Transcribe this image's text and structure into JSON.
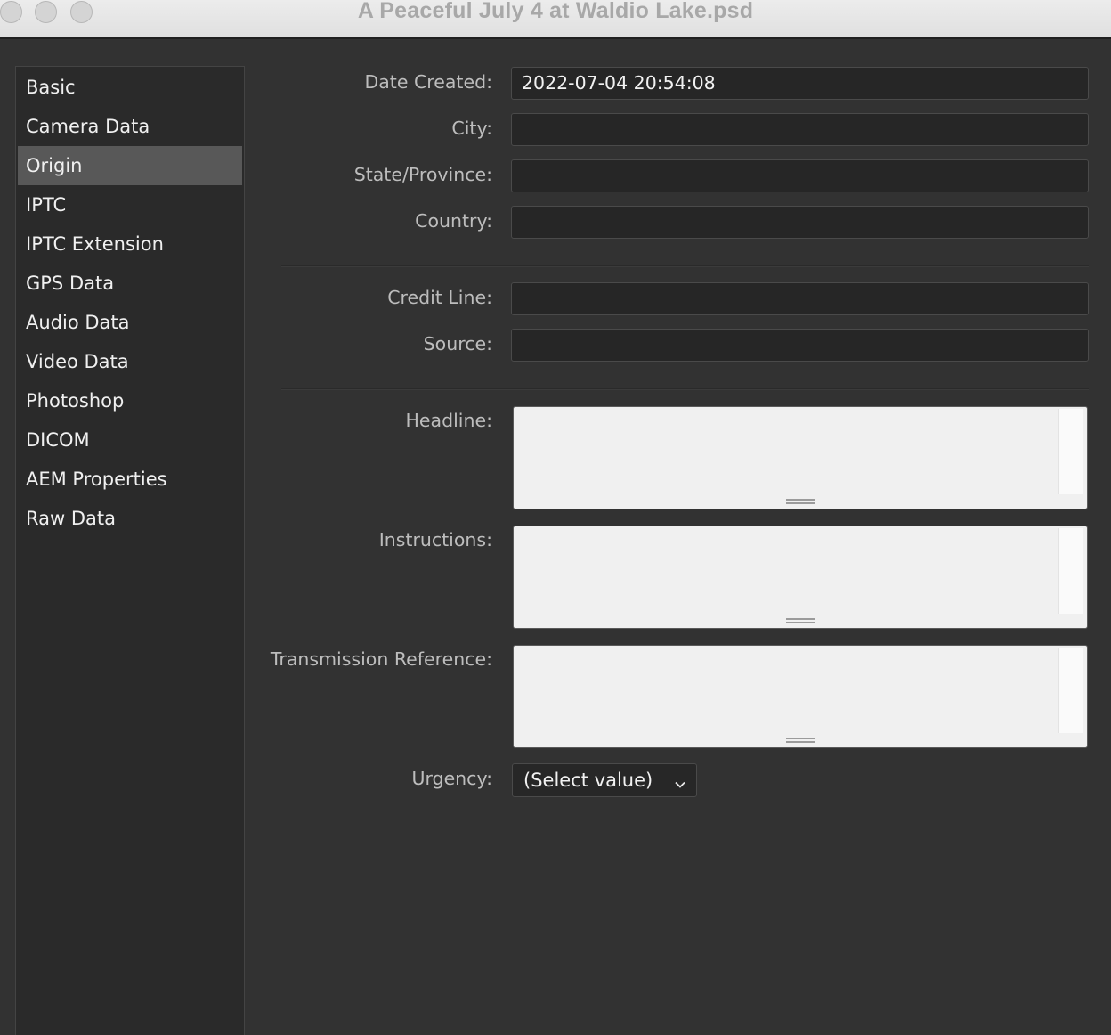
{
  "window": {
    "title": "A Peaceful July 4 at Waldio Lake.psd"
  },
  "sidebar": {
    "items": [
      {
        "label": "Basic",
        "selected": false
      },
      {
        "label": "Camera Data",
        "selected": false
      },
      {
        "label": "Origin",
        "selected": true
      },
      {
        "label": "IPTC",
        "selected": false
      },
      {
        "label": "IPTC Extension",
        "selected": false
      },
      {
        "label": "GPS Data",
        "selected": false
      },
      {
        "label": "Audio Data",
        "selected": false
      },
      {
        "label": "Video Data",
        "selected": false
      },
      {
        "label": "Photoshop",
        "selected": false
      },
      {
        "label": "DICOM",
        "selected": false
      },
      {
        "label": "AEM Properties",
        "selected": false
      },
      {
        "label": "Raw Data",
        "selected": false
      }
    ]
  },
  "form": {
    "date_created": {
      "label": "Date Created:",
      "value": "2022-07-04 20:54:08"
    },
    "city": {
      "label": "City:",
      "value": ""
    },
    "state": {
      "label": "State/Province:",
      "value": ""
    },
    "country": {
      "label": "Country:",
      "value": ""
    },
    "credit_line": {
      "label": "Credit Line:",
      "value": ""
    },
    "source": {
      "label": "Source:",
      "value": ""
    },
    "headline": {
      "label": "Headline:",
      "value": ""
    },
    "instructions": {
      "label": "Instructions:",
      "value": ""
    },
    "transmission_reference": {
      "label": "Transmission Reference:",
      "value": ""
    },
    "urgency": {
      "label": "Urgency:",
      "value": "(Select value)"
    }
  },
  "icons": {
    "dropdown": "chevron-down-icon"
  }
}
